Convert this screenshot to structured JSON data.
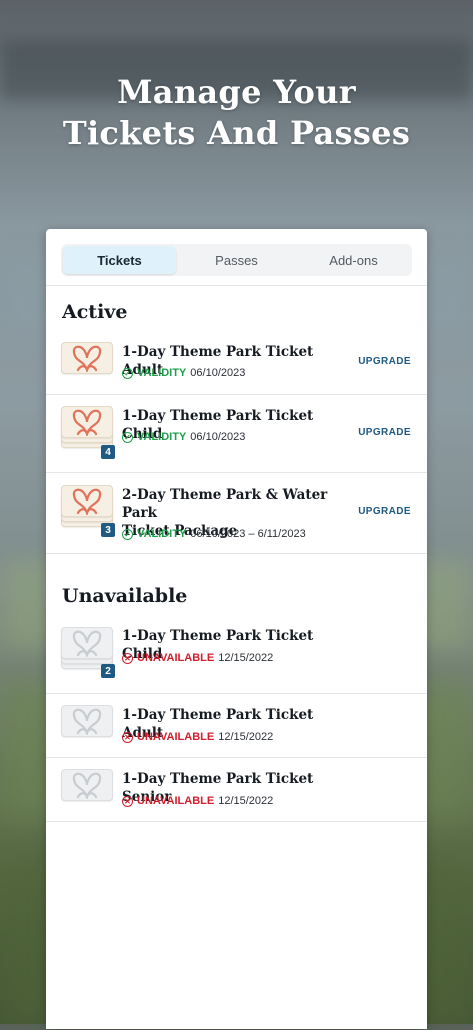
{
  "headline": {
    "line1": "Manage Your",
    "line2": "Tickets And Passes"
  },
  "tabs": [
    {
      "label": "Tickets",
      "active": true
    },
    {
      "label": "Passes",
      "active": false
    },
    {
      "label": "Add-ons",
      "active": false
    }
  ],
  "sections": {
    "active": "Active",
    "unavailable": "Unavailable"
  },
  "active_items": [
    {
      "title": "1-Day Theme Park Ticket Adult",
      "status": "VALIDITY",
      "date": "06/10/2023",
      "action": "UPGRADE",
      "count": ""
    },
    {
      "title": "1-Day Theme Park Ticket Child",
      "status": "VALIDITY",
      "date": "06/10/2023",
      "action": "UPGRADE",
      "count": "4"
    },
    {
      "title_line1": "2-Day Theme Park & Water Park",
      "title_line2": "Ticket Package",
      "status": "VALIDITY",
      "date": "06/10/2023 – 6/11/2023",
      "action": "UPGRADE",
      "count": "3"
    }
  ],
  "unavailable_items": [
    {
      "title": "1-Day Theme Park Ticket Child",
      "status": "UNAVAILABLE",
      "date": "12/15/2022",
      "count": "2"
    },
    {
      "title": "1-Day Theme Park Ticket Adult",
      "status": "UNAVAILABLE",
      "date": "12/15/2022",
      "count": ""
    },
    {
      "title": "1-Day Theme Park Ticket Senior",
      "status": "UNAVAILABLE",
      "date": "12/15/2022",
      "count": ""
    }
  ],
  "colors": {
    "accent_blue": "#1f5a84",
    "valid_green": "#1e9e4a",
    "unavailable_red": "#d21f2b",
    "butterfly_orange": "#e0735a"
  },
  "icons": {
    "ticket_logo": "butterfly-icon",
    "valid": "check-circle-icon",
    "unavailable": "x-circle-icon"
  }
}
